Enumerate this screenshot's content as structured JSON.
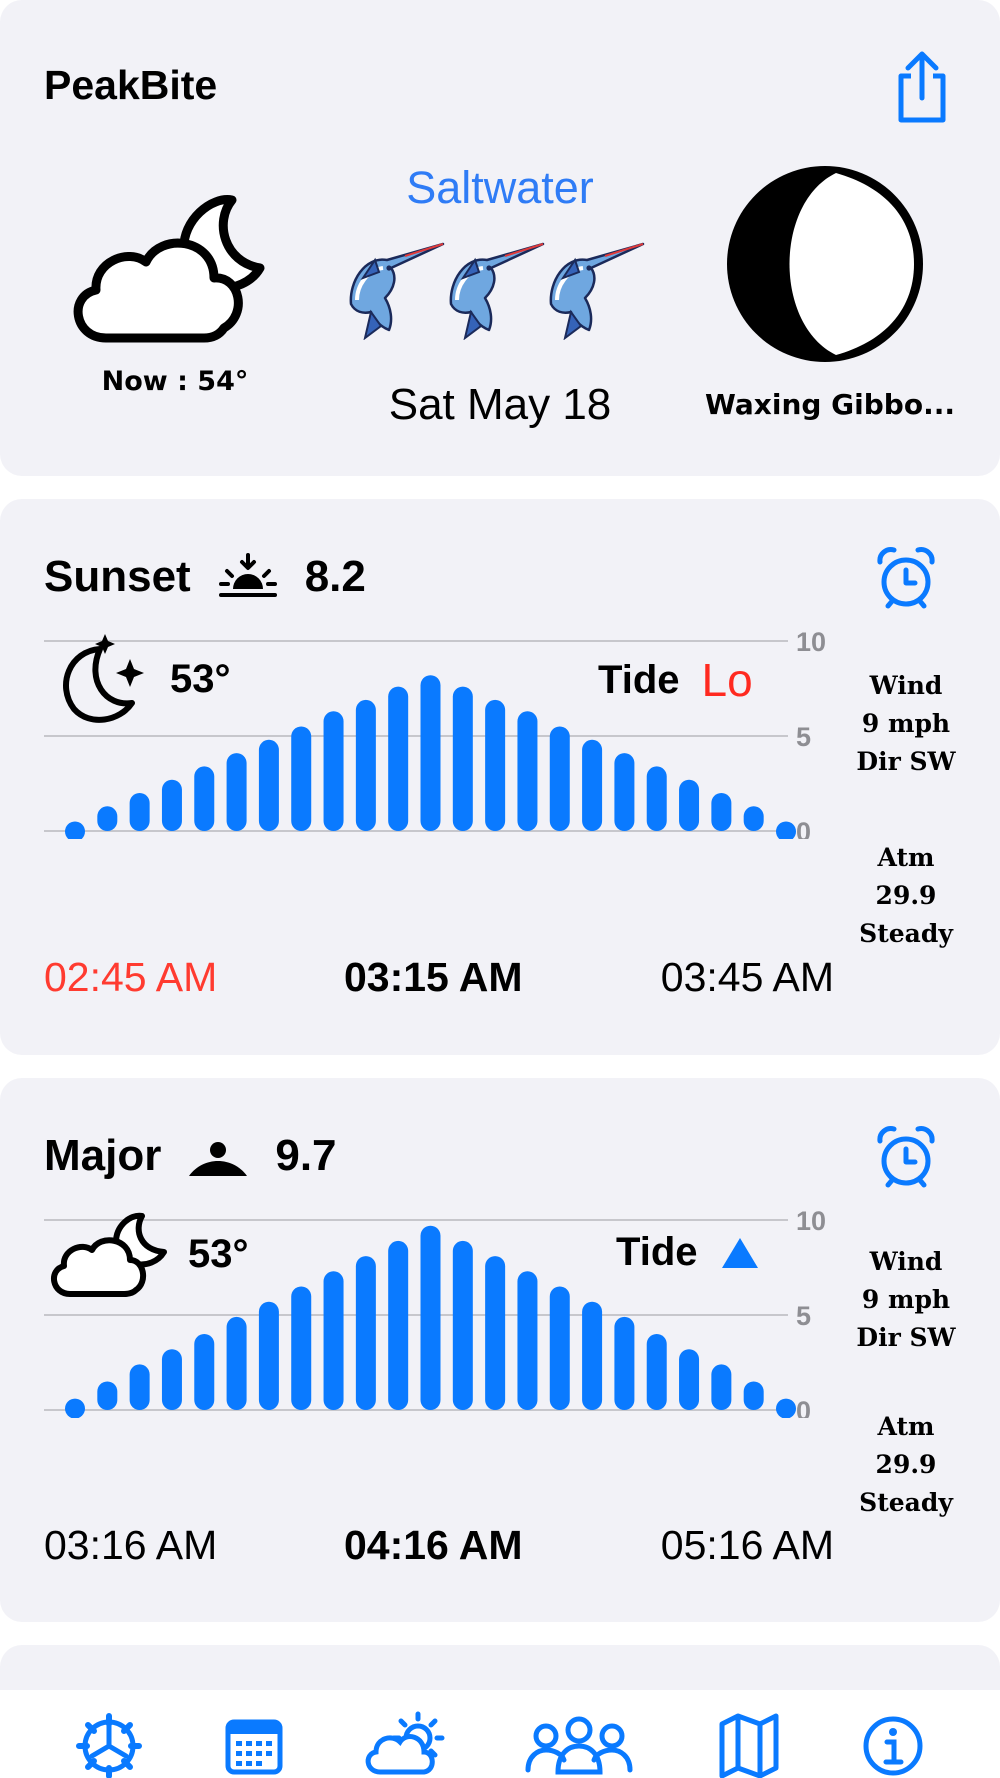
{
  "header": {
    "app_title": "PeakBite",
    "share_icon": "share-icon",
    "now_temp": "Now : 54°",
    "mode": "Saltwater",
    "date": "Sat May 18",
    "moon_phase": "Waxing Gibbo...",
    "rating_fish_count": 3
  },
  "periods": [
    {
      "name": "Sunset",
      "score": "8.2",
      "temp": "53°",
      "tide_label": "Tide",
      "tide_state": "Lo",
      "wind": [
        "Wind",
        "9 mph",
        "Dir SW"
      ],
      "atm": [
        "Atm",
        "29.9",
        "Steady"
      ],
      "times": {
        "start": "02:45 AM",
        "mid": "03:15 AM",
        "end": "03:45 AM"
      },
      "y_ticks": [
        "10",
        "5",
        "0"
      ],
      "chart_data": {
        "type": "bar",
        "ylim": [
          0,
          10
        ],
        "values": [
          0.5,
          1.3,
          2.0,
          2.7,
          3.4,
          4.1,
          4.8,
          5.5,
          6.3,
          6.9,
          7.6,
          8.2,
          7.6,
          6.9,
          6.3,
          5.5,
          4.8,
          4.1,
          3.4,
          2.7,
          2.0,
          1.3,
          0.5
        ]
      }
    },
    {
      "name": "Major",
      "score": "9.7",
      "temp": "53°",
      "tide_label": "Tide",
      "tide_state": "",
      "wind": [
        "Wind",
        "9 mph",
        "Dir SW"
      ],
      "atm": [
        "Atm",
        "29.9",
        "Steady"
      ],
      "times": {
        "start": "03:16 AM",
        "mid": "04:16 AM",
        "end": "05:16 AM"
      },
      "y_ticks": [
        "10",
        "5",
        "0"
      ],
      "chart_data": {
        "type": "bar",
        "ylim": [
          0,
          10
        ],
        "values": [
          0.6,
          1.5,
          2.4,
          3.2,
          4.0,
          4.9,
          5.7,
          6.5,
          7.3,
          8.1,
          8.9,
          9.7,
          8.9,
          8.1,
          7.3,
          6.5,
          5.7,
          4.9,
          4.0,
          3.2,
          2.4,
          1.5,
          0.6
        ]
      }
    }
  ],
  "tabs": [
    {
      "icon": "settings-gear-icon"
    },
    {
      "icon": "calendar-icon"
    },
    {
      "icon": "weather-icon"
    },
    {
      "icon": "community-icon"
    },
    {
      "icon": "map-icon"
    },
    {
      "icon": "info-icon"
    }
  ],
  "colors": {
    "accent": "#0a7aff",
    "alert": "#ff3b30",
    "card": "#f2f2f7"
  }
}
